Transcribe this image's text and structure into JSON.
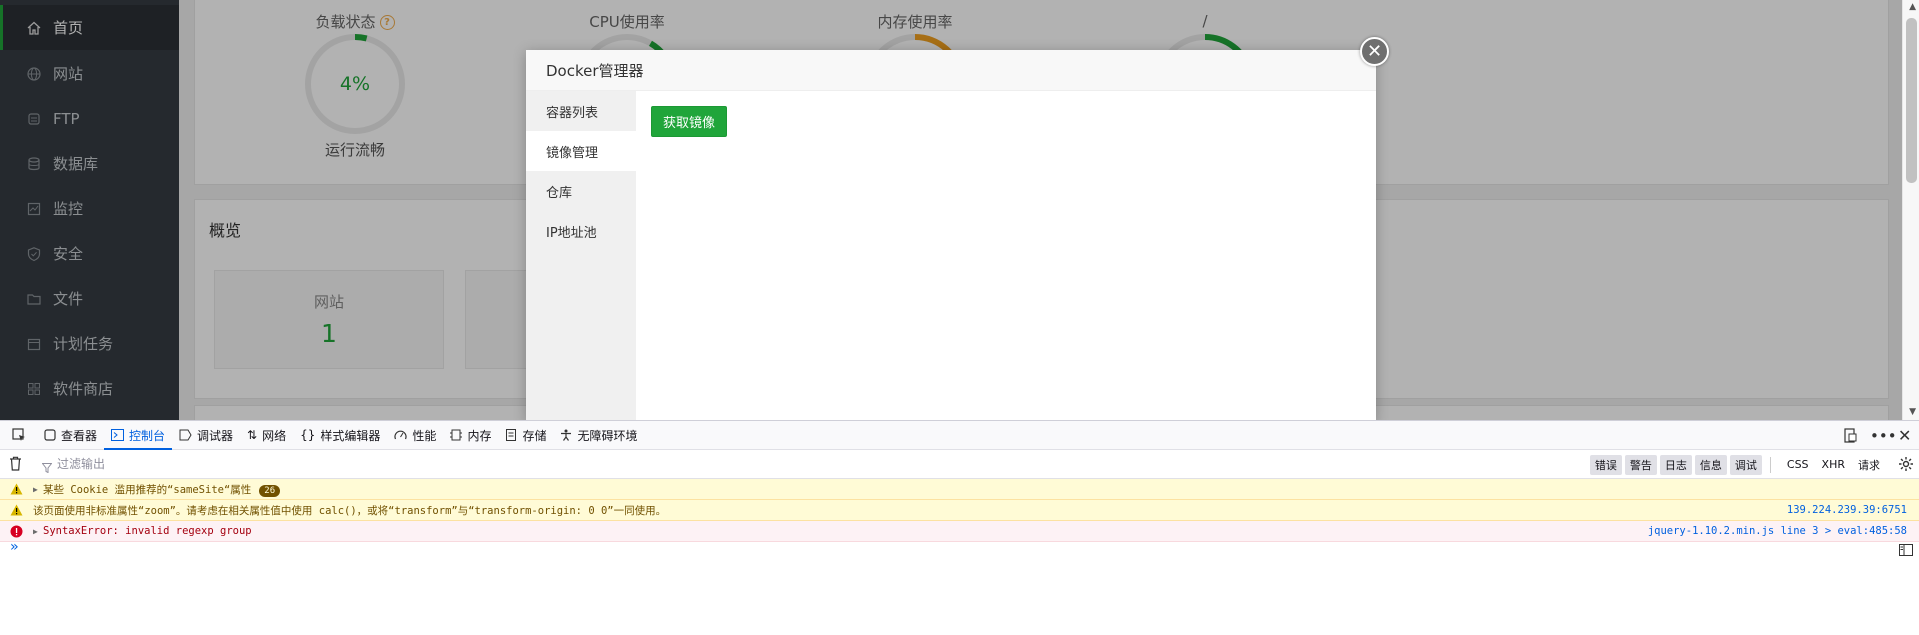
{
  "sidebar": {
    "items": [
      {
        "label": "首页",
        "icon": "home-icon",
        "active": true
      },
      {
        "label": "网站",
        "icon": "globe-icon"
      },
      {
        "label": "FTP",
        "icon": "ftp-icon"
      },
      {
        "label": "数据库",
        "icon": "database-icon"
      },
      {
        "label": "监控",
        "icon": "monitor-icon"
      },
      {
        "label": "安全",
        "icon": "shield-icon"
      },
      {
        "label": "文件",
        "icon": "folder-icon"
      },
      {
        "label": "计划任务",
        "icon": "calendar-icon"
      },
      {
        "label": "软件商店",
        "icon": "store-icon"
      }
    ]
  },
  "status": {
    "load_title": "负载状态",
    "load_value": "4%",
    "load_value_fraction": 0.04,
    "load_sub": "运行流畅",
    "cpu_title": "CPU使用率",
    "mem_title": "内存使用率",
    "disk_title": "/"
  },
  "overview": {
    "title": "概览",
    "site_label": "网站",
    "site_count": "1"
  },
  "modal": {
    "title": "Docker管理器",
    "tabs": [
      "容器列表",
      "镜像管理",
      "仓库",
      "IP地址池"
    ],
    "active_tab": 1,
    "pull_button": "获取镜像"
  },
  "devtools": {
    "tabs": [
      {
        "label": "查看器",
        "icon": "inspector-icon"
      },
      {
        "label": "控制台",
        "icon": "console-icon",
        "active": true
      },
      {
        "label": "调试器",
        "icon": "debugger-icon"
      },
      {
        "label": "网络",
        "icon": "network-icon"
      },
      {
        "label": "样式编辑器",
        "icon": "style-editor-icon"
      },
      {
        "label": "性能",
        "icon": "performance-icon"
      },
      {
        "label": "内存",
        "icon": "memory-icon"
      },
      {
        "label": "存储",
        "icon": "storage-icon"
      },
      {
        "label": "无障碍环境",
        "icon": "accessibility-icon"
      }
    ],
    "filter_placeholder": "过滤输出",
    "filter_buttons": [
      "错误",
      "警告",
      "日志",
      "信息",
      "调试"
    ],
    "filter_extra": [
      "CSS",
      "XHR",
      "请求"
    ],
    "messages": [
      {
        "level": "warn",
        "text": "某些 Cookie 滥用推荐的“sameSite“属性",
        "count": "26",
        "source": ""
      },
      {
        "level": "warn",
        "text": "该页面使用非标准属性“zoom”。请考虑在相关属性值中使用 calc()，或将“transform”与“transform-origin: 0 0”一同使用。",
        "source": "139.224.239.39:6751"
      },
      {
        "level": "error",
        "text": "SyntaxError: invalid regexp group",
        "source": "jquery-1.10.2.min.js line 3 > eval:485:58"
      }
    ],
    "prompt": "»"
  },
  "colors": {
    "accent_green": "#20a53a",
    "sidebar_bg": "#353c42",
    "devtools_blue": "#0060df",
    "gauge_orange": "#f0a020"
  }
}
